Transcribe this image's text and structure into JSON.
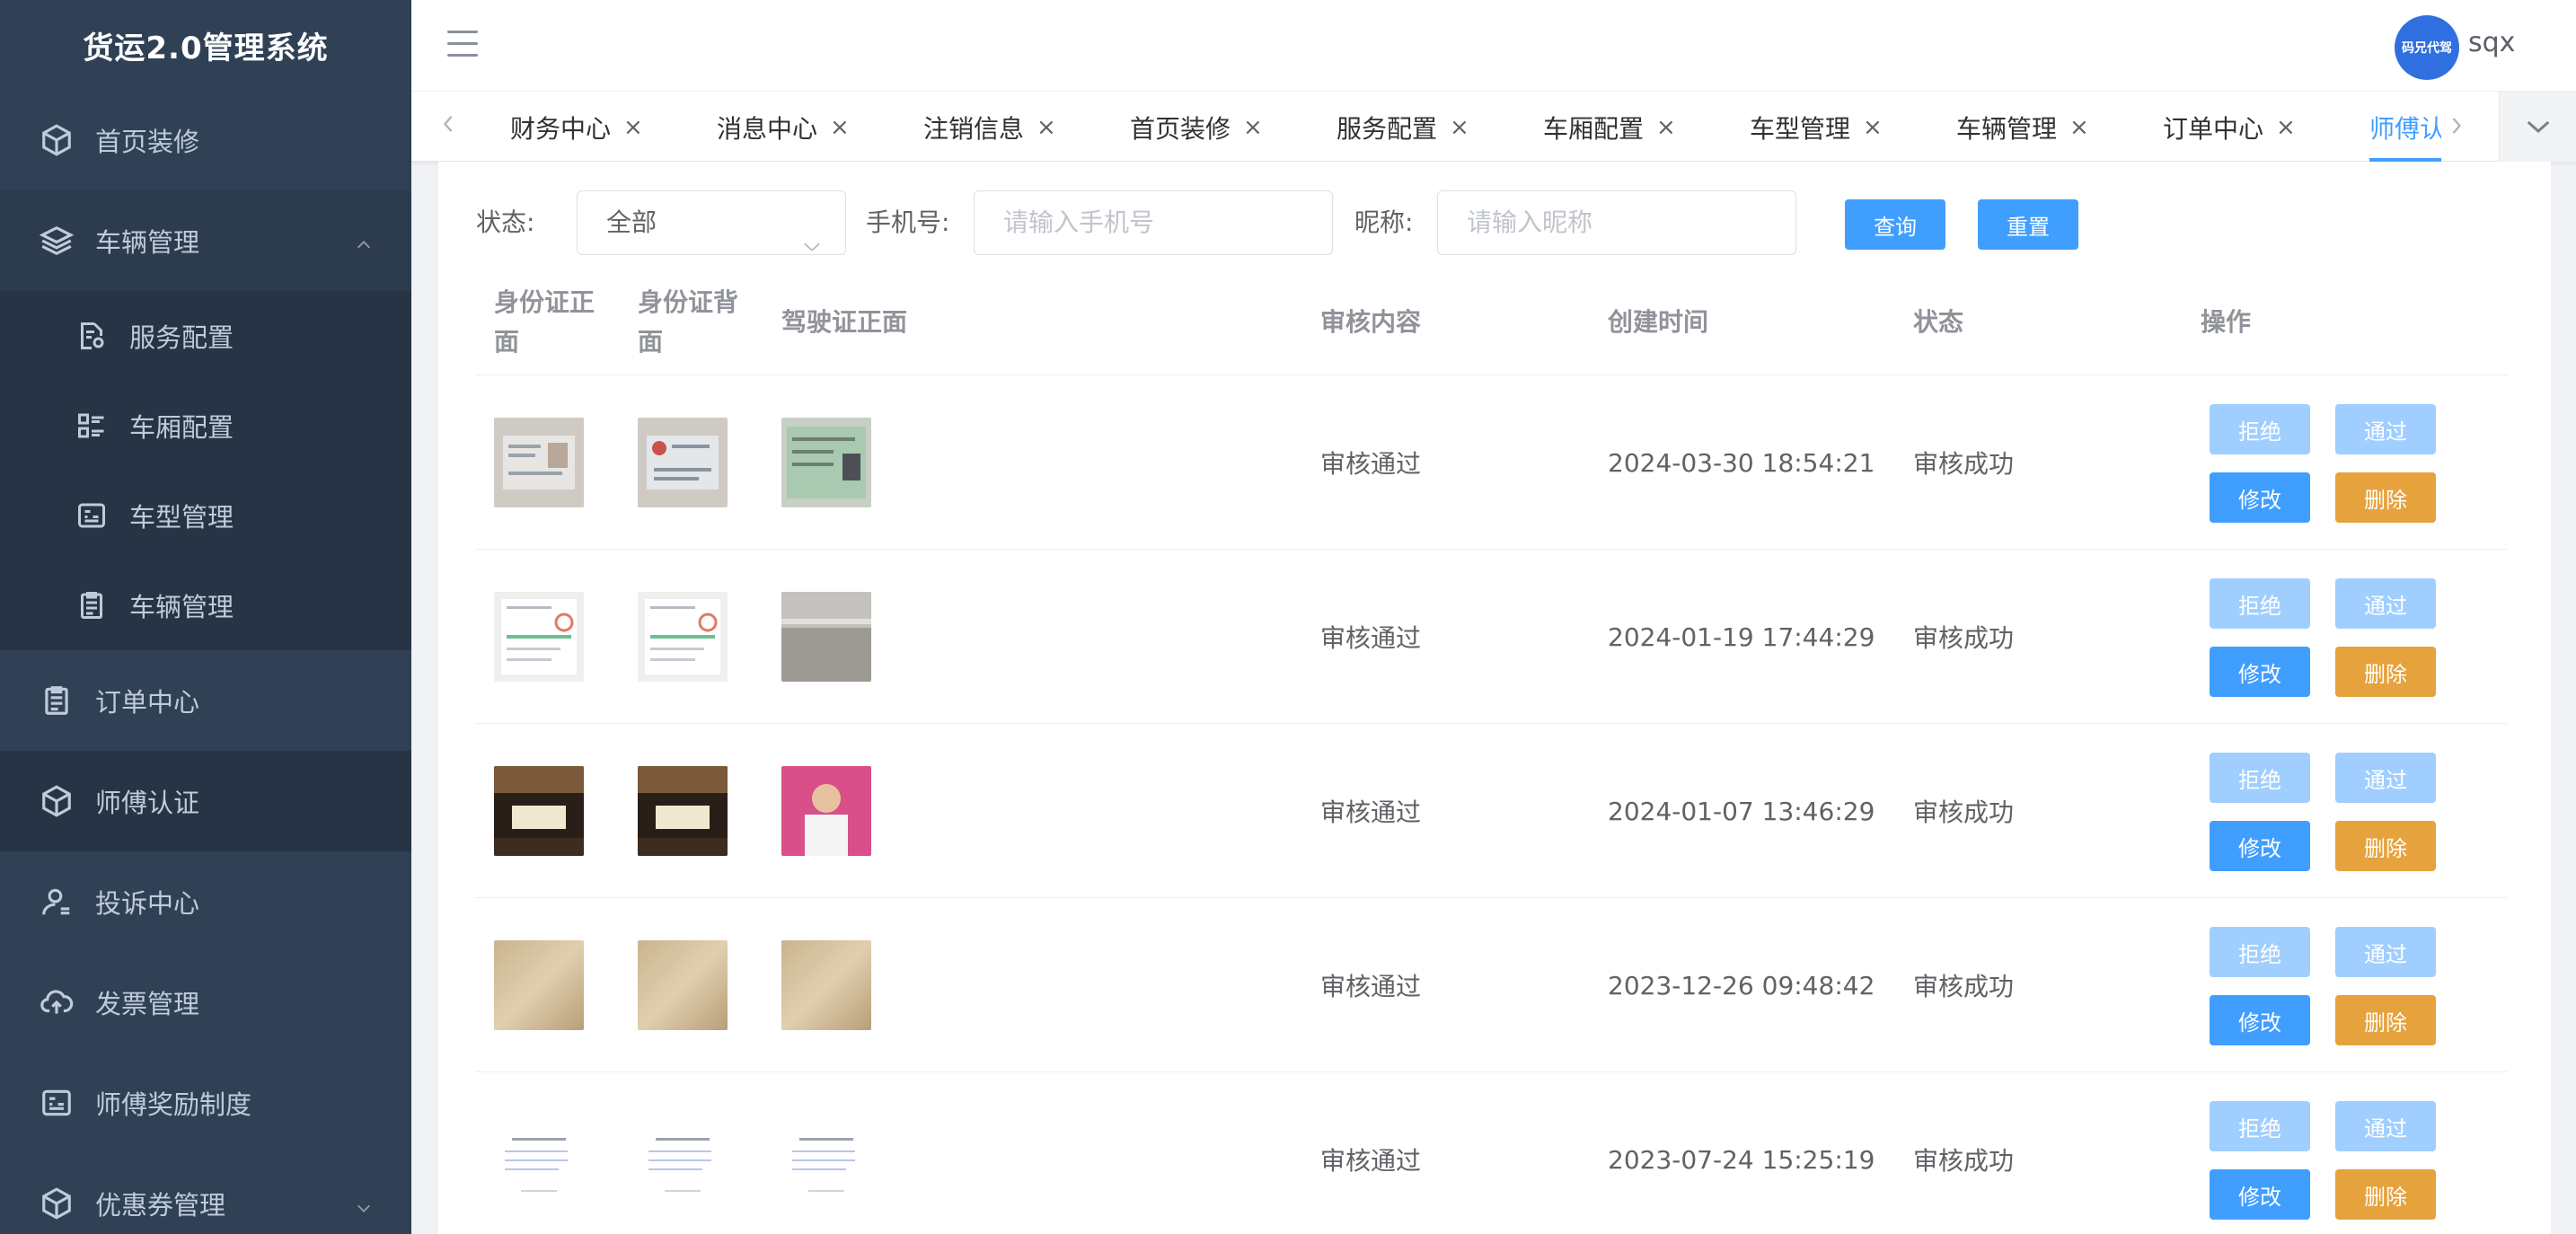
{
  "app": {
    "title": "货运2.0管理系统"
  },
  "sidebar": {
    "items": [
      {
        "label": "首页装修",
        "icon": "cube-icon"
      },
      {
        "label": "车辆管理",
        "icon": "layers-icon",
        "expanded": true
      },
      {
        "label": "订单中心",
        "icon": "clipboard-icon"
      },
      {
        "label": "师傅认证",
        "icon": "cube-icon"
      },
      {
        "label": "投诉中心",
        "icon": "user-icon"
      },
      {
        "label": "发票管理",
        "icon": "cloud-upload-icon"
      },
      {
        "label": "师傅奖励制度",
        "icon": "id-card-icon"
      },
      {
        "label": "优惠券管理",
        "icon": "cube-icon"
      }
    ],
    "submenu": [
      {
        "label": "服务配置",
        "icon": "doc-gear-icon"
      },
      {
        "label": "车厢配置",
        "icon": "list-icon"
      },
      {
        "label": "车型管理",
        "icon": "id-card-icon"
      },
      {
        "label": "车辆管理",
        "icon": "clipboard-icon"
      }
    ]
  },
  "header": {
    "avatar_text": "码兄代驾",
    "username": "sqx"
  },
  "tabs": [
    {
      "label": "财务中心"
    },
    {
      "label": "消息中心"
    },
    {
      "label": "注销信息"
    },
    {
      "label": "首页装修"
    },
    {
      "label": "服务配置"
    },
    {
      "label": "车厢配置"
    },
    {
      "label": "车型管理"
    },
    {
      "label": "车辆管理"
    },
    {
      "label": "订单中心"
    },
    {
      "label": "师傅认证",
      "active": true
    }
  ],
  "filter": {
    "status_label": "状态:",
    "status_value": "全部",
    "phone_label": "手机号:",
    "phone_placeholder": "请输入手机号",
    "nickname_label": "昵称:",
    "nickname_placeholder": "请输入昵称",
    "search_button": "查询",
    "reset_button": "重置"
  },
  "table": {
    "columns": {
      "id_front": "身份证正面",
      "id_back": "身份证背面",
      "license_front": "驾驶证正面",
      "review_content": "审核内容",
      "created_at": "创建时间",
      "status": "状态",
      "actions": "操作"
    },
    "rows": [
      {
        "review": "审核通过",
        "time": "2024-03-30 18:54:21",
        "status": "审核成功",
        "thumbs": [
          "id-card-photo",
          "id-card-back-photo",
          "license-photo"
        ]
      },
      {
        "review": "审核通过",
        "time": "2024-01-19 17:44:29",
        "status": "审核成功",
        "thumbs": [
          "screenshot-doc",
          "screenshot-doc",
          "desk-photo"
        ]
      },
      {
        "review": "审核通过",
        "time": "2024-01-07 13:46:29",
        "status": "审核成功",
        "thumbs": [
          "night-sign-photo",
          "night-sign-photo",
          "person-photo"
        ]
      },
      {
        "review": "审核通过",
        "time": "2023-12-26 09:48:42",
        "status": "审核成功",
        "thumbs": [
          "wood-photo",
          "wood-photo",
          "wood-photo"
        ]
      },
      {
        "review": "审核通过",
        "time": "2023-07-24 15:25:19",
        "status": "审核成功",
        "thumbs": [
          "white-doc",
          "white-doc",
          "white-doc"
        ]
      }
    ],
    "actions": {
      "reject": "拒绝",
      "pass": "通过",
      "edit": "修改",
      "delete": "删除"
    }
  },
  "colors": {
    "sidebar": "#304156",
    "primary": "#409eff",
    "primary_light": "#a0cfff",
    "warning": "#e6a23c"
  }
}
